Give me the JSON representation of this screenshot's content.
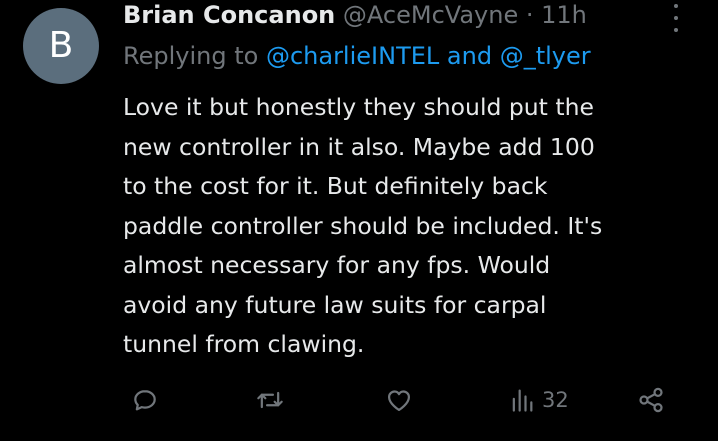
{
  "author": {
    "avatar_initial": "B",
    "display_name": "Brian Concanon",
    "handle": "@AceMcVayne",
    "separator": "·",
    "time": "11h"
  },
  "reply": {
    "prefix": "Replying to",
    "mention_1": "@charlieINTEL",
    "connector": "and",
    "mention_2": "@_tlyer"
  },
  "body": {
    "lines": [
      "Love it but honestly they should put the",
      "new controller in it also. Maybe add 100",
      "to the cost for it. But definitely back",
      "paddle controller should be included. It's",
      "almost necessary for any fps. Would",
      "avoid any future law suits for carpal",
      "tunnel from clawing."
    ]
  },
  "actions": {
    "views_count": "32",
    "icons": [
      "reply-icon",
      "retweet-icon",
      "like-icon",
      "views-icon",
      "share-icon"
    ]
  },
  "colors": {
    "background": "#000000",
    "primary_text": "#e7e9ea",
    "secondary_text": "#71767b",
    "link": "#1d9bf0",
    "avatar": "#5b6e7d"
  }
}
